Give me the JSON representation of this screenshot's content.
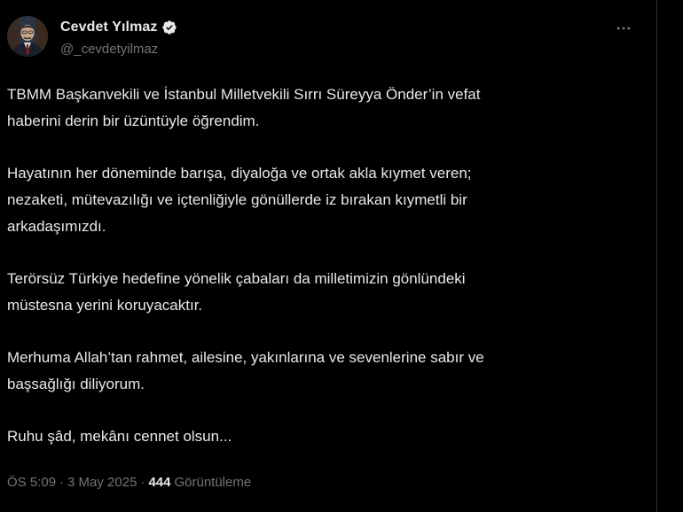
{
  "author": {
    "name": "Cevdet Yılmaz",
    "handle": "@_cevdetyilmaz",
    "verified": true
  },
  "tweet": {
    "paragraphs": [
      "TBMM Başkanvekili ve İstanbul Milletvekili Sırrı Süreyya Önder’in vefat\nhaberini derin bir üzüntüyle öğrendim.",
      "Hayatının her döneminde barışa, diyaloğa ve ortak akla kıymet veren;\nnezaketi, mütevazılığı ve içtenliğiyle gönüllerde iz bırakan kıymetli bir\narkadaşımızdı.",
      "Terörsüz Türkiye hedefine yönelik çabaları da milletimizin gönlündeki\nmüstesna yerini koruyacaktır.",
      "Merhuma Allah’tan rahmet, ailesine, yakınlarına ve sevenlerine sabır ve\nbaşsağlığı diliyorum.",
      "Ruhu şâd, mekânı cennet olsun..."
    ]
  },
  "meta": {
    "time": "ÖS 5:09",
    "separator": "·",
    "date": "3 May 2025",
    "views_count": "444",
    "views_label": "Görüntüleme"
  },
  "icons": {
    "verified": "verified-badge-icon",
    "more": "more-horizontal-icon"
  },
  "colors": {
    "background": "#000000",
    "text": "#e7e9ea",
    "secondary": "#71767b",
    "verified_badge": "#e7e9ea"
  }
}
